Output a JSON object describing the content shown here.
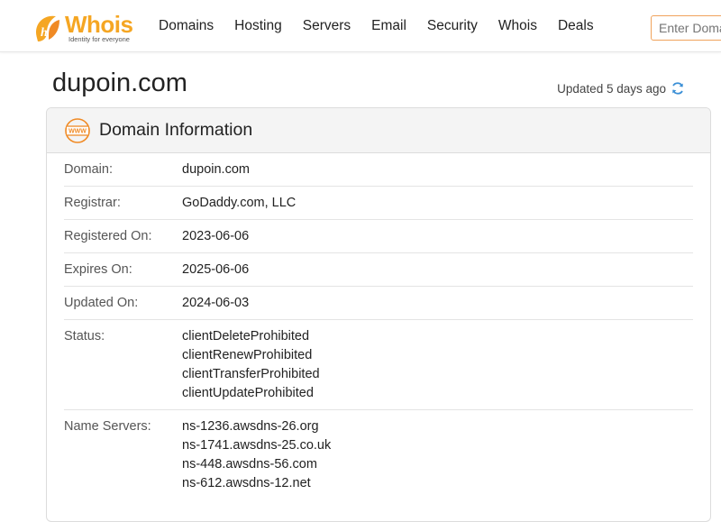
{
  "header": {
    "logo_text": "Whois",
    "logo_tagline": "Identity for everyone",
    "nav": [
      "Domains",
      "Hosting",
      "Servers",
      "Email",
      "Security",
      "Whois",
      "Deals"
    ],
    "search_placeholder": "Enter Domain"
  },
  "page": {
    "title": "dupoin.com",
    "updated_text": "Updated 5 days ago"
  },
  "card": {
    "title": "Domain Information",
    "icon": "www-icon",
    "rows": [
      {
        "label": "Domain:",
        "values": [
          "dupoin.com"
        ]
      },
      {
        "label": "Registrar:",
        "values": [
          "GoDaddy.com, LLC"
        ]
      },
      {
        "label": "Registered On:",
        "values": [
          "2023-06-06"
        ]
      },
      {
        "label": "Expires On:",
        "values": [
          "2025-06-06"
        ]
      },
      {
        "label": "Updated On:",
        "values": [
          "2024-06-03"
        ]
      },
      {
        "label": "Status:",
        "values": [
          "clientDeleteProhibited",
          "clientRenewProhibited",
          "clientTransferProhibited",
          "clientUpdateProhibited"
        ]
      },
      {
        "label": "Name Servers:",
        "values": [
          "ns-1236.awsdns-26.org",
          "ns-1741.awsdns-25.co.uk",
          "ns-448.awsdns-56.com",
          "ns-612.awsdns-12.net"
        ]
      }
    ]
  },
  "colors": {
    "accent": "#f5a623",
    "refresh": "#3a8fd6",
    "search_border": "#f0a35c"
  }
}
